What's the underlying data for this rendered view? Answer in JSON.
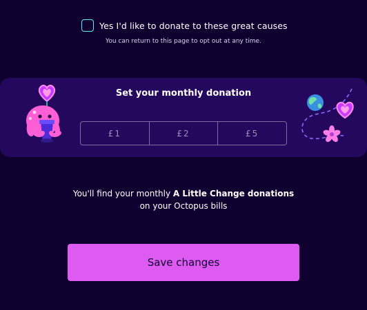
{
  "consent": {
    "label": "Yes I'd like to donate to these great causes",
    "note": "You can return to this page to opt out at any time.",
    "checked": false
  },
  "donation": {
    "title": "Set your monthly donation",
    "options": [
      {
        "label": "£1"
      },
      {
        "label": "£2"
      },
      {
        "label": "£5"
      }
    ]
  },
  "info": {
    "prefix": "You'll find your monthly ",
    "highlight": "A Little Change donations",
    "suffix": "on your Octopus bills"
  },
  "actions": {
    "save_label": "Save changes"
  },
  "colors": {
    "background": "#100030",
    "band": "#23085e",
    "accent": "#dd5bf0",
    "checkbox_border": "#60f0f8",
    "option_border": "#7d6e9e"
  },
  "icons": {
    "mascot": "octopus-holding-heart-plant-icon",
    "decoration": "globe-heart-flower-icon"
  }
}
